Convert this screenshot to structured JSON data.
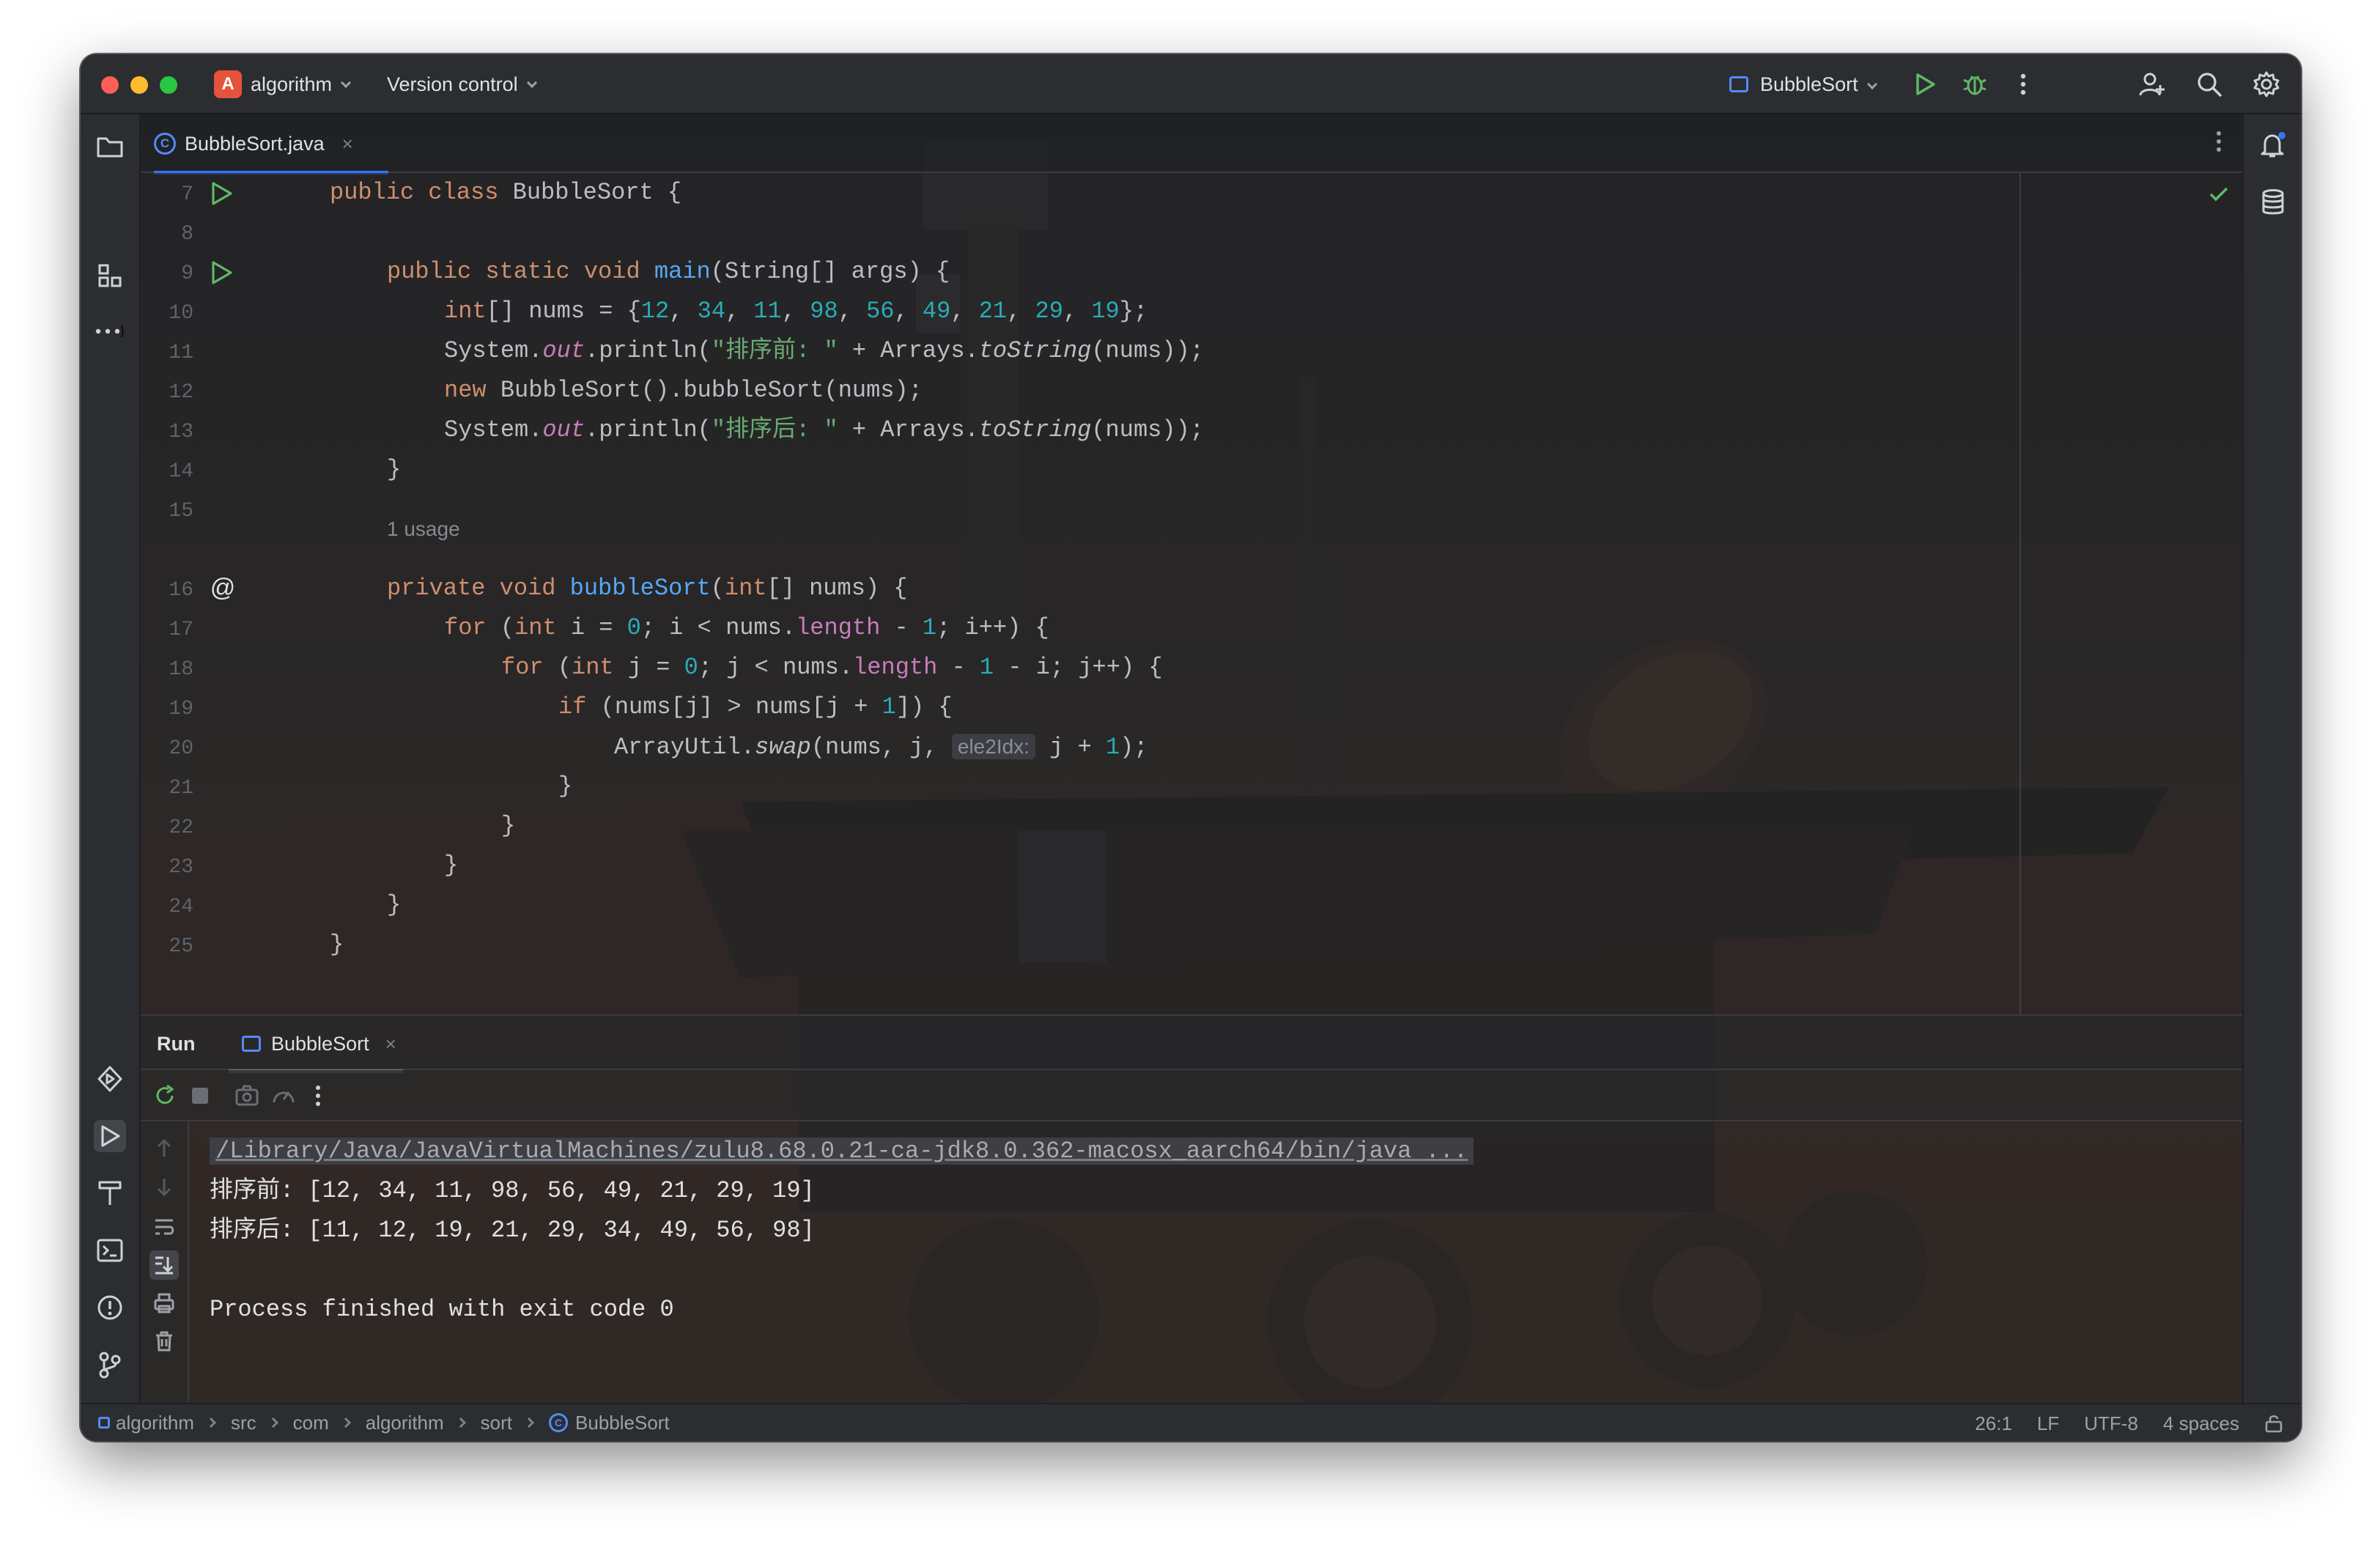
{
  "window": {
    "project_badge": "A",
    "project_name": "algorithm",
    "vcs_label": "Version control",
    "run_config": "BubbleSort"
  },
  "editor": {
    "tab": {
      "label": "BubbleSort.java",
      "close": "×"
    },
    "usage_hint": "1 usage",
    "param_hint": "ele2Idx:",
    "lines": [
      "7",
      "8",
      "9",
      "10",
      "11",
      "12",
      "13",
      "14",
      "15",
      "16",
      "17",
      "18",
      "19",
      "20",
      "21",
      "22",
      "23",
      "24",
      "25"
    ]
  },
  "code": {
    "l7": {
      "kw1": "public",
      "kw2": "class",
      "name": "BubbleSort {"
    },
    "l9": {
      "kw": "public static void",
      "fn": "main",
      "rest": "(String[] args) {"
    },
    "l10": {
      "kw": "int",
      "a": "[] nums = {",
      "n1": "12",
      "n2": "34",
      "n3": "11",
      "n4": "98",
      "n5": "56",
      "n6": "49",
      "n7": "21",
      "n8": "29",
      "n9": "19",
      "end": "};"
    },
    "l11": {
      "a": "System.",
      "out": "out",
      "b": ".println(",
      "str": "\"排序前: \"",
      "c": " + Arrays.",
      "m": "toString",
      "d": "(nums));"
    },
    "l12": {
      "kw": "new",
      "rest": " BubbleSort().bubbleSort(nums);"
    },
    "l13": {
      "a": "System.",
      "out": "out",
      "b": ".println(",
      "str": "\"排序后: \"",
      "c": " + Arrays.",
      "m": "toString",
      "d": "(nums));"
    },
    "l16": {
      "kw1": "private",
      "kw2": "void",
      "fn": "bubbleSort",
      "a": "(",
      "kw3": "int",
      "b": "[] nums) {"
    },
    "l17": {
      "kw": "for",
      "a": " (",
      "kw2": "int",
      "b": " i = ",
      "n0": "0",
      "c": "; i < nums.",
      "f": "length",
      "d": " - ",
      "n1": "1",
      "e": "; i++) {"
    },
    "l18": {
      "kw": "for",
      "a": " (",
      "kw2": "int",
      "b": " j = ",
      "n0": "0",
      "c": "; j < nums.",
      "f": "length",
      "d": " - ",
      "n1": "1",
      "e": " - i; j++) {"
    },
    "l19": {
      "kw": "if",
      "a": " (nums[j] > nums[j + ",
      "n1": "1",
      "b": "]) {"
    },
    "l20": {
      "a": "ArrayUtil.",
      "m": "swap",
      "b": "(nums, j, ",
      "c": " j + ",
      "n1": "1",
      "d": ");"
    },
    "brace": "}"
  },
  "run": {
    "title": "Run",
    "tab_label": "BubbleSort",
    "tab_close": "×",
    "console": {
      "path": "/Library/Java/JavaVirtualMachines/zulu8.68.0.21-ca-jdk8.0.362-macosx_aarch64/bin/java ...",
      "before": "排序前: [12, 34, 11, 98, 56, 49, 21, 29, 19]",
      "after": "排序后: [11, 12, 19, 21, 29, 34, 49, 56, 98]",
      "exit": "Process finished with exit code 0"
    }
  },
  "status": {
    "crumbs": [
      "algorithm",
      "src",
      "com",
      "algorithm",
      "sort",
      "BubbleSort"
    ],
    "position": "26:1",
    "line_sep": "LF",
    "encoding": "UTF-8",
    "indent": "4 spaces"
  },
  "icons": [
    "folder-icon",
    "structure-icon",
    "more-icon",
    "services-icon",
    "run-icon",
    "build-icon",
    "terminal-icon",
    "problems-icon",
    "git-icon",
    "notifications-icon",
    "database-icon",
    "add-user-icon",
    "search-icon",
    "settings-icon",
    "debug-icon",
    "lock-icon"
  ]
}
